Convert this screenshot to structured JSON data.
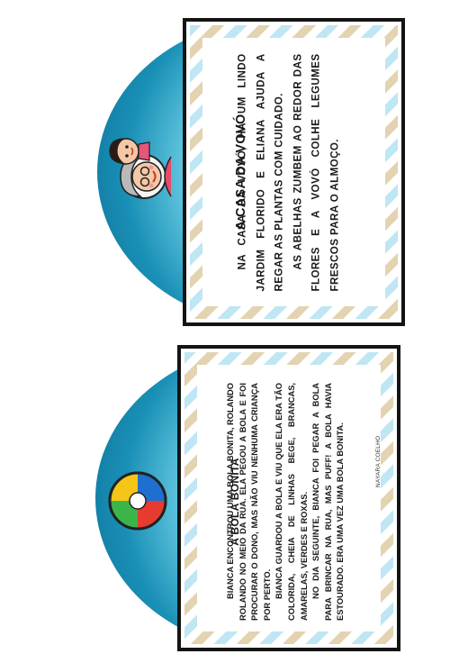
{
  "cards": [
    {
      "title": "A BOLA BONITA",
      "paragraphs": [
        "BIANCA ENCONTROU UMA BOLA BONITA, ROLANDO ROLANDO NO MEIO DA RUA. ELA PEGOU A BOLA E FOI PROCURAR O DONO, MAS NÃO VIU NENHUMA CRIANÇA POR PERTO.",
        "BIANCA GUARDOU A BOLA E VIU QUE ELA ERA TÃO COLORIDA, CHEIA DE LINHAS BEGE, BRANCAS, AMARELAS, VERDES E ROXAS.",
        "NO DIA SEGUINTE, BIANCA FOI PEGAR A BOLA PARA BRINCAR NA RUA, MAS PUFF! A BOLA HAVIA ESTOURADO. ERA UMA VEZ UMA BOLA BONITA."
      ],
      "author": "NAYARA COELHO",
      "icon": "beach-ball-icon"
    },
    {
      "title": "A CASA DA VOVÓ",
      "paragraphs": [
        "NA CASA DA VOVÓ, HÁ UM LINDO JARDIM FLORIDO E ELIANA AJUDA A REGAR AS PLANTAS COM CUIDADO.",
        "AS ABELHAS ZUMBEM AO REDOR DAS FLORES E A VOVÓ COLHE LEGUMES FRESCOS PARA O ALMOÇO."
      ],
      "icon": "grandmother-and-girl-icon"
    }
  ],
  "colors": {
    "teal_dark": "#0b6f97",
    "teal_light": "#5cc2dc",
    "chevron_blue": "#bfe6f3",
    "chevron_beige": "#e3d3b1",
    "frame": "#141414"
  }
}
